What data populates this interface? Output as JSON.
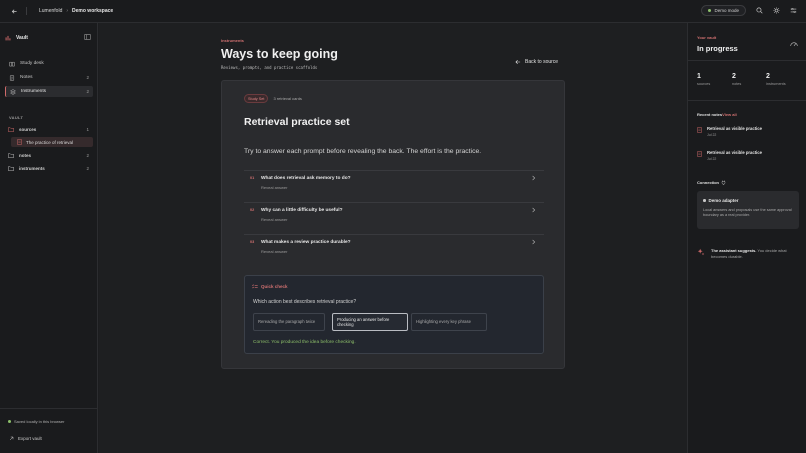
{
  "topbar": {
    "back_icon": "back-arrow-icon",
    "breadcrumb": [
      "Lumenfold",
      "Demo workspace"
    ],
    "demo_mode": "Demo mode",
    "icons": [
      "search-icon",
      "sun-icon",
      "settings-sliders-icon"
    ]
  },
  "sidebar": {
    "brand": "Vault",
    "nav": [
      {
        "label": "Study desk",
        "count": ""
      },
      {
        "label": "Notes",
        "count": "2"
      },
      {
        "label": "Instruments",
        "count": "2"
      }
    ],
    "section": "VAULT",
    "tree": [
      {
        "label": "sources",
        "count": "1"
      },
      {
        "label": "notes",
        "count": "2"
      },
      {
        "label": "instruments",
        "count": "2"
      }
    ],
    "tree_child": "The practice of retrieval",
    "saved": "Saved locally in this browser",
    "export": "Export vault"
  },
  "main": {
    "eyebrow": "Instruments",
    "title": "Ways to keep going",
    "subtitle": "Reviews, prompts, and practice scaffolds",
    "back_label": "Back to source",
    "card": {
      "badge": "Study Set",
      "count": "3 retrieval cards",
      "title": "Retrieval practice set",
      "intro": "Try to answer each prompt before revealing the back. The effort is the practice.",
      "prompts": [
        {
          "num": "01",
          "question": "What does retrieval ask memory to do?",
          "reveal": "Reveal answer"
        },
        {
          "num": "02",
          "question": "Why can a little difficulty be useful?",
          "reveal": "Reveal answer"
        },
        {
          "num": "03",
          "question": "What makes a review practice durable?",
          "reveal": "Reveal answer"
        }
      ],
      "quick_check": {
        "label": "Quick check",
        "question": "Which action best describes retrieval practice?",
        "options": [
          "Rereading the paragraph twice",
          "Producing an answer before checking",
          "Highlighting every key phrase"
        ],
        "selected": 1,
        "feedback": "Correct. You produced the idea before checking."
      }
    }
  },
  "rpanel": {
    "eyebrow": "Your vault",
    "title": "In progress",
    "stats": [
      {
        "n": "1",
        "l": "sources"
      },
      {
        "n": "2",
        "l": "notes"
      },
      {
        "n": "2",
        "l": "instruments"
      }
    ],
    "recent_label": "Recent notes",
    "view_all": "View all",
    "notes": [
      {
        "title": "Retrieval as visible practice",
        "date": "Jul 22"
      },
      {
        "title": "Retrieval as visible practice",
        "date": "Jul 22"
      }
    ],
    "connection_label": "Connection",
    "adapter_title": "Demo adapter",
    "adapter_body": "Local answers and proposals use the same approval boundary as a real provider.",
    "assistant_strong": "The assistant suggests.",
    "assistant_rest": " You decide what becomes durable."
  }
}
